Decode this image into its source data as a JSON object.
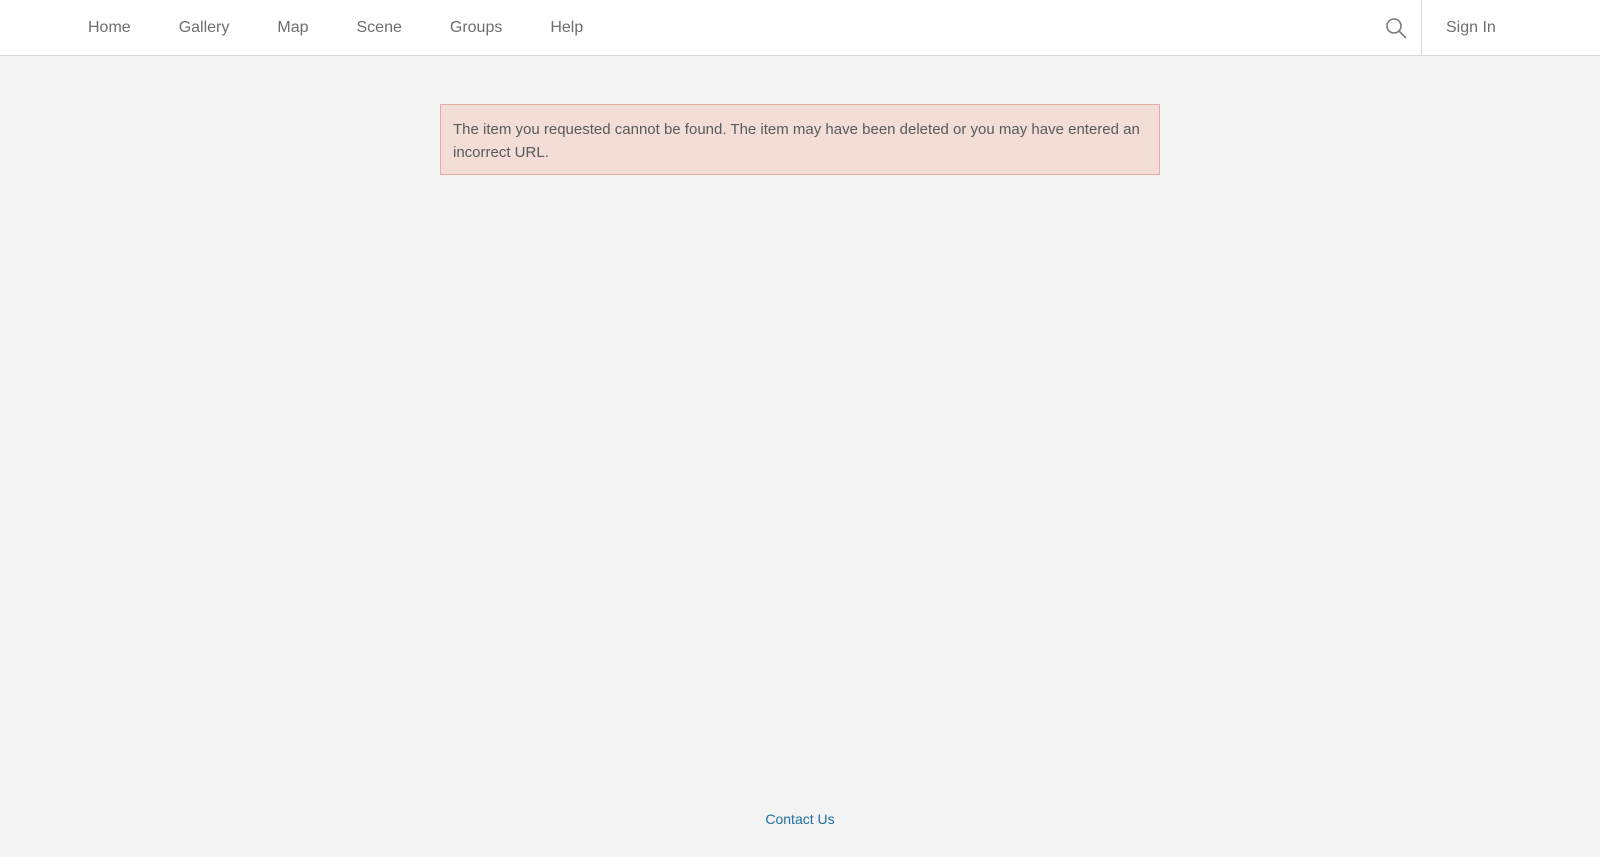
{
  "nav": {
    "items": [
      {
        "label": "Home"
      },
      {
        "label": "Gallery"
      },
      {
        "label": "Map"
      },
      {
        "label": "Scene"
      },
      {
        "label": "Groups"
      },
      {
        "label": "Help"
      }
    ],
    "search_icon": "search-icon",
    "signin_label": "Sign In"
  },
  "alert": {
    "message": "The item you requested cannot be found. The item may have been deleted or you may have entered an incorrect URL."
  },
  "footer": {
    "contact_label": "Contact Us"
  },
  "colors": {
    "page_background": "#f3f3f3",
    "alert_background": "#f2ddd7",
    "alert_border": "#e2aea4",
    "link": "#1f6fa3"
  }
}
